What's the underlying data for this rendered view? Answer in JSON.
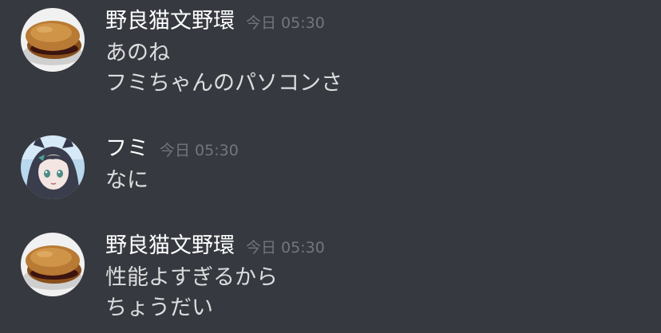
{
  "messages": [
    {
      "username": "野良猫文野環",
      "timestamp": "今日 05:30",
      "avatar_icon": "dorayaki-avatar-icon",
      "lines": [
        "あのね",
        "フミちゃんのパソコンさ"
      ]
    },
    {
      "username": "フミ",
      "timestamp": "今日 05:30",
      "avatar_icon": "anime-girl-avatar-icon",
      "lines": [
        "なに"
      ]
    },
    {
      "username": "野良猫文野環",
      "timestamp": "今日 05:30",
      "avatar_icon": "dorayaki-avatar-icon",
      "lines": [
        "性能よすぎるから",
        "ちょうだい"
      ]
    }
  ],
  "colors": {
    "background": "#36393f",
    "username": "#ffffff",
    "message_text": "#dcddde",
    "timestamp": "#72767d"
  }
}
